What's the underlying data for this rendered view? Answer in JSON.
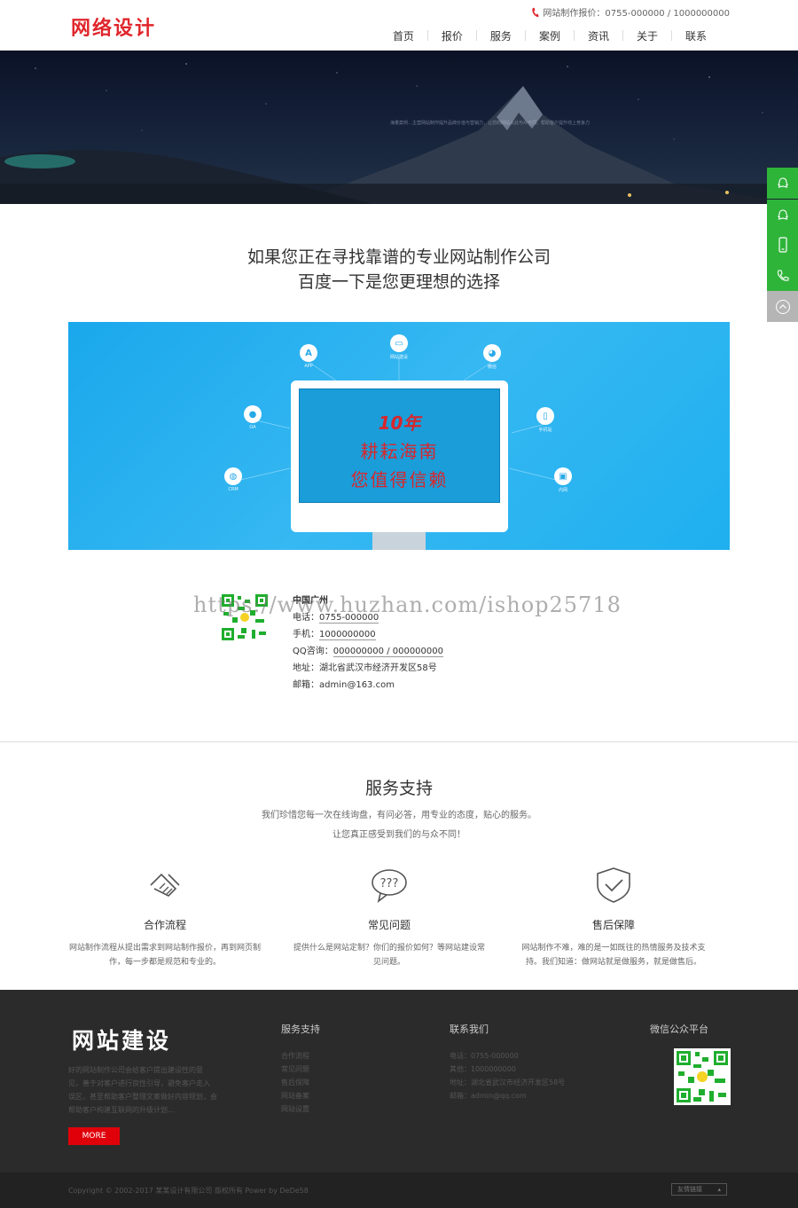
{
  "header": {
    "logo": "网络设计",
    "phone": "网站制作报价：0755-000000 / 1000000000",
    "nav": [
      "首页",
      "报价",
      "服务",
      "案例",
      "资讯",
      "关于",
      "联系"
    ]
  },
  "banner": {
    "hint": "海量案例…主营网站制作提升品牌价值与营销力，让您的网站从此与众不同，帮助客户提升线上竞争力"
  },
  "intro": {
    "line1": "如果您正在寻找靠谱的专业网站制作公司",
    "line2": "百度一下是您更理想的选择"
  },
  "promo": {
    "year": "10年",
    "line1": "耕耘海南",
    "line2": "您值得信赖",
    "nodes": [
      "APP",
      "网站建设",
      "微信",
      "OA",
      "手机站",
      "CRM",
      "内网"
    ]
  },
  "contact": {
    "city": "中国广州",
    "tel_label": "电话：",
    "tel": "0755-000000",
    "mobile_label": "手机：",
    "mobile": "1000000000",
    "qq_label": "QQ咨询：",
    "qq": "000000000 / 000000000",
    "addr_label": "地址：",
    "addr": "湖北省武汉市经济开发区58号",
    "mail_label": "邮箱：",
    "mail": "admin@163.com",
    "watermark": "https://www.huzhan.com/ishop25718"
  },
  "service": {
    "title": "服务支持",
    "sub1": "我们珍惜您每一次在线询盘，有问必答，用专业的态度，贴心的服务。",
    "sub2": "让您真正感受到我们的与众不同！",
    "cols": [
      {
        "name": "合作流程",
        "desc1": "网站制作流程从提出需求到网站制作报价，再到网页制",
        "desc2": "作，每一步都是规范和专业的。",
        "icon": "handshake-icon"
      },
      {
        "name": "常见问题",
        "desc1": "提供什么是网站定制？你们的报价如何？等网站建设常",
        "desc2": "见问题。",
        "icon": "question-bubble-icon"
      },
      {
        "name": "售后保障",
        "desc1": "网站制作不难，难的是一如既往的热情服务及技术支",
        "desc2": "持。我们知道：做网站就是做服务，就是做售后。",
        "icon": "shield-check-icon"
      }
    ]
  },
  "footer": {
    "logo": "网站建设",
    "about1": "好的网站制作公司会给客户提出建设性的意",
    "about2": "见，善于对客户进行良性引导，避免客户走入",
    "about3": "误区，甚至帮助客户整理文案做好内容规划，会",
    "about4": "帮助客户构建互联网的升级计划...",
    "more": "MORE",
    "col1_title": "服务支持",
    "col1": [
      "合作流程",
      "常见问题",
      "售后保障",
      "网站备案",
      "网站设置"
    ],
    "col2_title": "联系我们",
    "col2": [
      "电话：0755-000000",
      "其他：1000000000",
      "地址：湖北省武汉市经济开发区58号",
      "邮箱：admin@qq.com"
    ],
    "col3_title": "微信公众平台",
    "copyright": "Copyright © 2002-2017 某某设计有限公司 版权所有 Power by DeDe58",
    "friend": "友情链接"
  },
  "colors": {
    "brand": "#e0262c",
    "side_green": "#2fb43a",
    "side_gray": "#b5b5b5",
    "promo_blue": "#1fb0ef"
  }
}
